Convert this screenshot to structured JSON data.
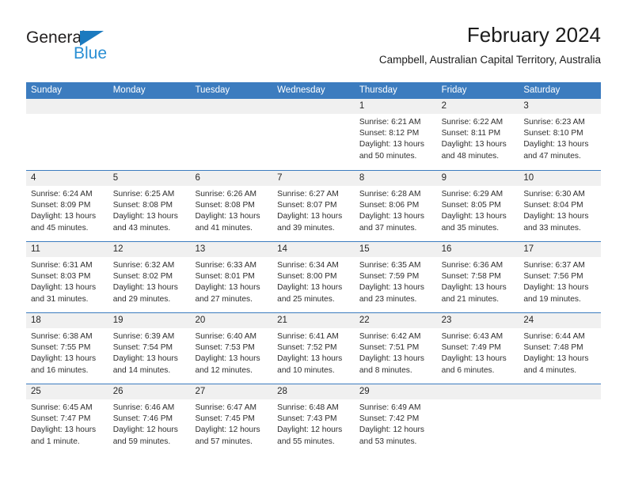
{
  "brand": {
    "name_part1": "General",
    "name_part2": "Blue",
    "triangle_color": "#1b7abf",
    "blue_color": "#2a8fd4"
  },
  "header": {
    "title": "February 2024",
    "subtitle": "Campbell, Australian Capital Territory, Australia"
  },
  "theme": {
    "header_blue": "#3c7cbf",
    "day_band_gray": "#f0f0f0",
    "text_color": "#2e2e2e"
  },
  "weekdays": [
    "Sunday",
    "Monday",
    "Tuesday",
    "Wednesday",
    "Thursday",
    "Friday",
    "Saturday"
  ],
  "weeks": [
    [
      {
        "day": "",
        "lines": []
      },
      {
        "day": "",
        "lines": []
      },
      {
        "day": "",
        "lines": []
      },
      {
        "day": "",
        "lines": []
      },
      {
        "day": "1",
        "lines": [
          "Sunrise: 6:21 AM",
          "Sunset: 8:12 PM",
          "Daylight: 13 hours",
          "and 50 minutes."
        ]
      },
      {
        "day": "2",
        "lines": [
          "Sunrise: 6:22 AM",
          "Sunset: 8:11 PM",
          "Daylight: 13 hours",
          "and 48 minutes."
        ]
      },
      {
        "day": "3",
        "lines": [
          "Sunrise: 6:23 AM",
          "Sunset: 8:10 PM",
          "Daylight: 13 hours",
          "and 47 minutes."
        ]
      }
    ],
    [
      {
        "day": "4",
        "lines": [
          "Sunrise: 6:24 AM",
          "Sunset: 8:09 PM",
          "Daylight: 13 hours",
          "and 45 minutes."
        ]
      },
      {
        "day": "5",
        "lines": [
          "Sunrise: 6:25 AM",
          "Sunset: 8:08 PM",
          "Daylight: 13 hours",
          "and 43 minutes."
        ]
      },
      {
        "day": "6",
        "lines": [
          "Sunrise: 6:26 AM",
          "Sunset: 8:08 PM",
          "Daylight: 13 hours",
          "and 41 minutes."
        ]
      },
      {
        "day": "7",
        "lines": [
          "Sunrise: 6:27 AM",
          "Sunset: 8:07 PM",
          "Daylight: 13 hours",
          "and 39 minutes."
        ]
      },
      {
        "day": "8",
        "lines": [
          "Sunrise: 6:28 AM",
          "Sunset: 8:06 PM",
          "Daylight: 13 hours",
          "and 37 minutes."
        ]
      },
      {
        "day": "9",
        "lines": [
          "Sunrise: 6:29 AM",
          "Sunset: 8:05 PM",
          "Daylight: 13 hours",
          "and 35 minutes."
        ]
      },
      {
        "day": "10",
        "lines": [
          "Sunrise: 6:30 AM",
          "Sunset: 8:04 PM",
          "Daylight: 13 hours",
          "and 33 minutes."
        ]
      }
    ],
    [
      {
        "day": "11",
        "lines": [
          "Sunrise: 6:31 AM",
          "Sunset: 8:03 PM",
          "Daylight: 13 hours",
          "and 31 minutes."
        ]
      },
      {
        "day": "12",
        "lines": [
          "Sunrise: 6:32 AM",
          "Sunset: 8:02 PM",
          "Daylight: 13 hours",
          "and 29 minutes."
        ]
      },
      {
        "day": "13",
        "lines": [
          "Sunrise: 6:33 AM",
          "Sunset: 8:01 PM",
          "Daylight: 13 hours",
          "and 27 minutes."
        ]
      },
      {
        "day": "14",
        "lines": [
          "Sunrise: 6:34 AM",
          "Sunset: 8:00 PM",
          "Daylight: 13 hours",
          "and 25 minutes."
        ]
      },
      {
        "day": "15",
        "lines": [
          "Sunrise: 6:35 AM",
          "Sunset: 7:59 PM",
          "Daylight: 13 hours",
          "and 23 minutes."
        ]
      },
      {
        "day": "16",
        "lines": [
          "Sunrise: 6:36 AM",
          "Sunset: 7:58 PM",
          "Daylight: 13 hours",
          "and 21 minutes."
        ]
      },
      {
        "day": "17",
        "lines": [
          "Sunrise: 6:37 AM",
          "Sunset: 7:56 PM",
          "Daylight: 13 hours",
          "and 19 minutes."
        ]
      }
    ],
    [
      {
        "day": "18",
        "lines": [
          "Sunrise: 6:38 AM",
          "Sunset: 7:55 PM",
          "Daylight: 13 hours",
          "and 16 minutes."
        ]
      },
      {
        "day": "19",
        "lines": [
          "Sunrise: 6:39 AM",
          "Sunset: 7:54 PM",
          "Daylight: 13 hours",
          "and 14 minutes."
        ]
      },
      {
        "day": "20",
        "lines": [
          "Sunrise: 6:40 AM",
          "Sunset: 7:53 PM",
          "Daylight: 13 hours",
          "and 12 minutes."
        ]
      },
      {
        "day": "21",
        "lines": [
          "Sunrise: 6:41 AM",
          "Sunset: 7:52 PM",
          "Daylight: 13 hours",
          "and 10 minutes."
        ]
      },
      {
        "day": "22",
        "lines": [
          "Sunrise: 6:42 AM",
          "Sunset: 7:51 PM",
          "Daylight: 13 hours",
          "and 8 minutes."
        ]
      },
      {
        "day": "23",
        "lines": [
          "Sunrise: 6:43 AM",
          "Sunset: 7:49 PM",
          "Daylight: 13 hours",
          "and 6 minutes."
        ]
      },
      {
        "day": "24",
        "lines": [
          "Sunrise: 6:44 AM",
          "Sunset: 7:48 PM",
          "Daylight: 13 hours",
          "and 4 minutes."
        ]
      }
    ],
    [
      {
        "day": "25",
        "lines": [
          "Sunrise: 6:45 AM",
          "Sunset: 7:47 PM",
          "Daylight: 13 hours",
          "and 1 minute."
        ]
      },
      {
        "day": "26",
        "lines": [
          "Sunrise: 6:46 AM",
          "Sunset: 7:46 PM",
          "Daylight: 12 hours",
          "and 59 minutes."
        ]
      },
      {
        "day": "27",
        "lines": [
          "Sunrise: 6:47 AM",
          "Sunset: 7:45 PM",
          "Daylight: 12 hours",
          "and 57 minutes."
        ]
      },
      {
        "day": "28",
        "lines": [
          "Sunrise: 6:48 AM",
          "Sunset: 7:43 PM",
          "Daylight: 12 hours",
          "and 55 minutes."
        ]
      },
      {
        "day": "29",
        "lines": [
          "Sunrise: 6:49 AM",
          "Sunset: 7:42 PM",
          "Daylight: 12 hours",
          "and 53 minutes."
        ]
      },
      {
        "day": "",
        "lines": []
      },
      {
        "day": "",
        "lines": []
      }
    ]
  ]
}
